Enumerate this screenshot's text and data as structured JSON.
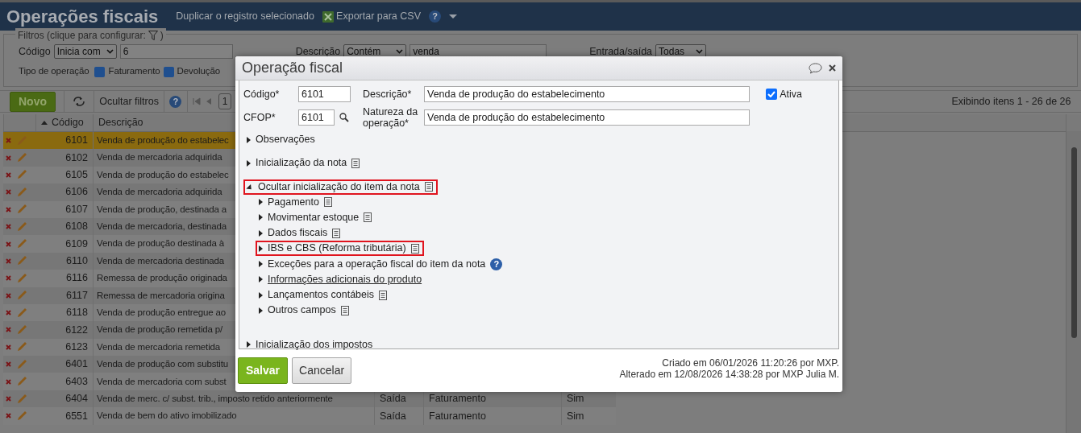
{
  "header": {
    "title": "Operações fiscais",
    "duplicate": "Duplicar o registro selecionado",
    "export": "Exportar para CSV",
    "help_icon": "?"
  },
  "filters": {
    "legend": "Filtros (clique para configurar:",
    "legend_end": ")",
    "codigo": {
      "label": "Código",
      "operator": "Inicia com",
      "value": "6"
    },
    "descricao": {
      "label": "Descrição",
      "operator": "Contém",
      "value": "venda"
    },
    "entrada_saida": {
      "label": "Entrada/saída",
      "value": "Todas"
    },
    "tipo_operacao": {
      "label": "Tipo de operação",
      "options": [
        {
          "label": "Faturamento",
          "checked": true
        },
        {
          "label": "Devolução",
          "checked": true
        }
      ]
    }
  },
  "toolbar": {
    "new": "Novo",
    "hide_filters": "Ocultar filtros",
    "help_icon": "?",
    "page": "1",
    "summary": "Exibindo itens 1 - 26 de 26"
  },
  "table": {
    "columns": [
      {
        "label": "Código",
        "sorted": true
      },
      {
        "label": "Descrição",
        "sorted": false
      }
    ],
    "rows": [
      {
        "code": "6101",
        "description": "Venda de produção do estabelec",
        "selected": true
      },
      {
        "code": "6102",
        "description": "Venda de mercadoria adquirida",
        "selected": false
      },
      {
        "code": "6105",
        "description": "Venda de produção do estabelec",
        "selected": false
      },
      {
        "code": "6106",
        "description": "Venda de mercadoria adquirida",
        "selected": false
      },
      {
        "code": "6107",
        "description": "Venda de produção, destinada a",
        "selected": false
      },
      {
        "code": "6108",
        "description": "Venda de mercadoria, destinada",
        "selected": false
      },
      {
        "code": "6109",
        "description": "Venda de produção destinada à",
        "selected": false
      },
      {
        "code": "6110",
        "description": "Venda de mercadoria destinada",
        "selected": false
      },
      {
        "code": "6116",
        "description": "Remessa de produção originada",
        "selected": false
      },
      {
        "code": "6117",
        "description": "Remessa de mercadoria origina",
        "selected": false
      },
      {
        "code": "6118",
        "description": "Venda de produção entregue ao",
        "selected": false
      },
      {
        "code": "6122",
        "description": "Venda de produção remetida p/",
        "selected": false
      },
      {
        "code": "6123",
        "description": "Venda de mercadoria remetida",
        "selected": false
      },
      {
        "code": "6401",
        "description": "Venda de produção com substitu",
        "selected": false
      },
      {
        "code": "6403",
        "description": "Venda de mercadoria com subst",
        "selected": false
      },
      {
        "code": "6404",
        "description": "Venda de merc. c/ subst. trib., imposto retido anteriormente",
        "direction": "Saída",
        "type": "Faturamento",
        "flag": "Sim",
        "selected": false
      },
      {
        "code": "6551",
        "description": "Venda de bem do ativo imobilizado",
        "direction": "Saída",
        "type": "Faturamento",
        "flag": "Sim",
        "selected": false
      }
    ]
  },
  "modal": {
    "title": "Operação fiscal",
    "codigo": {
      "label": "Código*",
      "value": "6101"
    },
    "descricao": {
      "label": "Descrição*",
      "value": "Venda de produção do estabelecimento"
    },
    "cfop": {
      "label": "CFOP*",
      "value": "6101"
    },
    "natureza": {
      "label": "Natureza da operação*",
      "value": "Venda de produção do estabelecimento"
    },
    "ativa": {
      "label": "Ativa",
      "checked": true
    },
    "sections": [
      {
        "label": "Observações",
        "expanded": false,
        "highlighted": false,
        "notes": false
      },
      {
        "label": "Inicialização da nota",
        "expanded": false,
        "highlighted": false,
        "notes": true
      },
      {
        "label": "Ocultar inicialização do item da nota",
        "expanded": true,
        "highlighted": true,
        "notes": true,
        "children": [
          {
            "label": "Pagamento",
            "expanded": false,
            "highlighted": false,
            "notes": true
          },
          {
            "label": "Movimentar estoque",
            "expanded": false,
            "highlighted": false,
            "notes": true
          },
          {
            "label": "Dados fiscais",
            "expanded": false,
            "highlighted": false,
            "notes": true
          },
          {
            "label": "IBS e CBS (Reforma tributária)",
            "expanded": false,
            "highlighted": true,
            "notes": true
          },
          {
            "label": "Exceções para a operação fiscal do item da nota",
            "expanded": false,
            "highlighted": false,
            "notes": false,
            "help_icon": "?"
          },
          {
            "label": "Informações adicionais do produto",
            "expanded": false,
            "highlighted": false,
            "notes": false,
            "link": true
          },
          {
            "label": "Lançamentos contábeis",
            "expanded": false,
            "highlighted": false,
            "notes": true
          },
          {
            "label": "Outros campos",
            "expanded": false,
            "highlighted": false,
            "notes": true
          }
        ]
      },
      {
        "label": "Inicialização dos impostos",
        "expanded": false,
        "highlighted": false,
        "notes": false
      }
    ],
    "save": "Salvar",
    "cancel": "Cancelar",
    "created": "Criado em 06/01/2026 11:20:26 por MXP.",
    "altered": "Alterado em 12/08/2026 14:38:28 por MXP Julia M."
  }
}
